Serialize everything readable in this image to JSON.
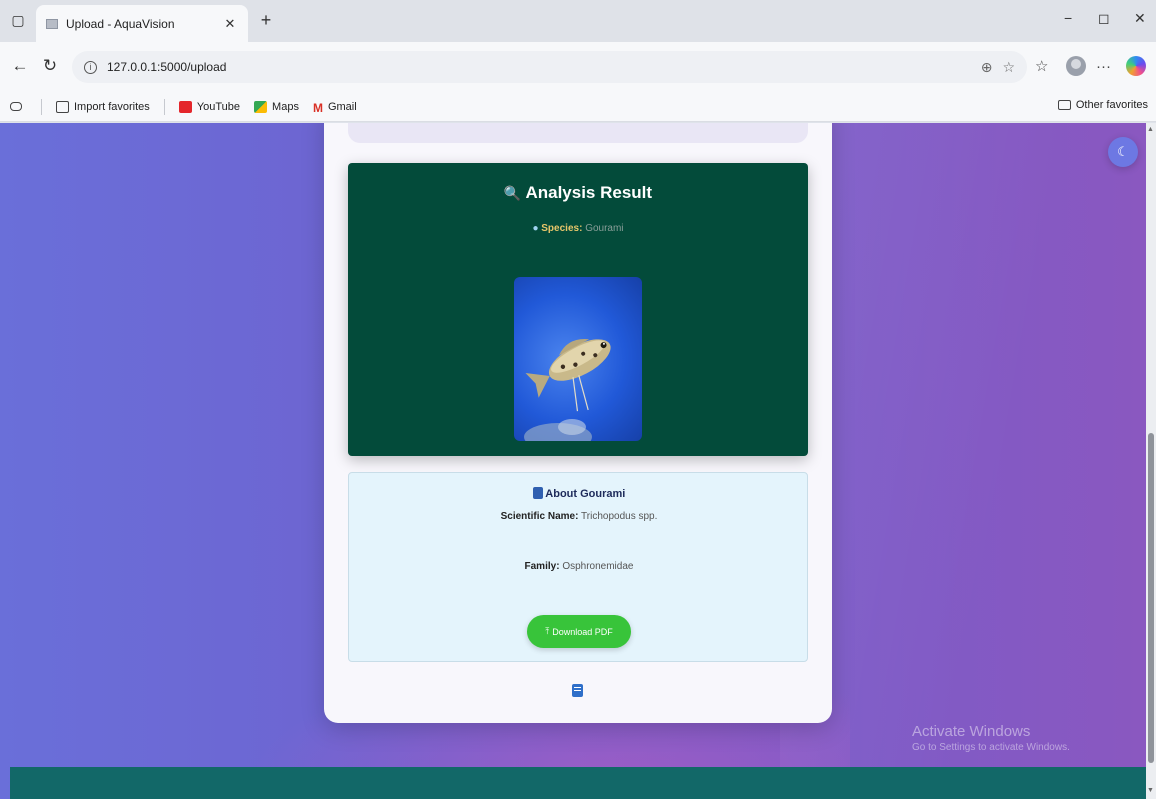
{
  "browser": {
    "tab_title": "Upload - AquaVision",
    "url": "127.0.0.1:5000/upload",
    "bookmarks": [
      "Import favorites",
      "YouTube",
      "Maps",
      "Gmail"
    ],
    "other_favorites": "Other favorites"
  },
  "result": {
    "title": "Analysis Result",
    "species_label": "Species:",
    "species_value": "Gourami"
  },
  "about": {
    "title": "About Gourami",
    "scientific_label": "Scientific Name:",
    "scientific_value": "Trichopodus spp.",
    "family_label": "Family:",
    "family_value": "Osphronemidae",
    "download_label": "Download PDF"
  },
  "watermark": {
    "line1": "Activate Windows",
    "line2": "Go to Settings to activate Windows."
  },
  "colors": {
    "result_card": "#034b3a",
    "about_card": "#e4f4fc",
    "download_button": "#38c43a",
    "bottom_band": "#126868"
  },
  "icons": [
    "sidebar-icon",
    "new-tab-icon",
    "back-icon",
    "refresh-icon",
    "zoom-icon",
    "favorite-star-icon",
    "favorites-icon",
    "profile-avatar",
    "more-icon",
    "copilot-icon",
    "moon-icon",
    "magnifier-icon",
    "book-icon",
    "upload-icon"
  ]
}
